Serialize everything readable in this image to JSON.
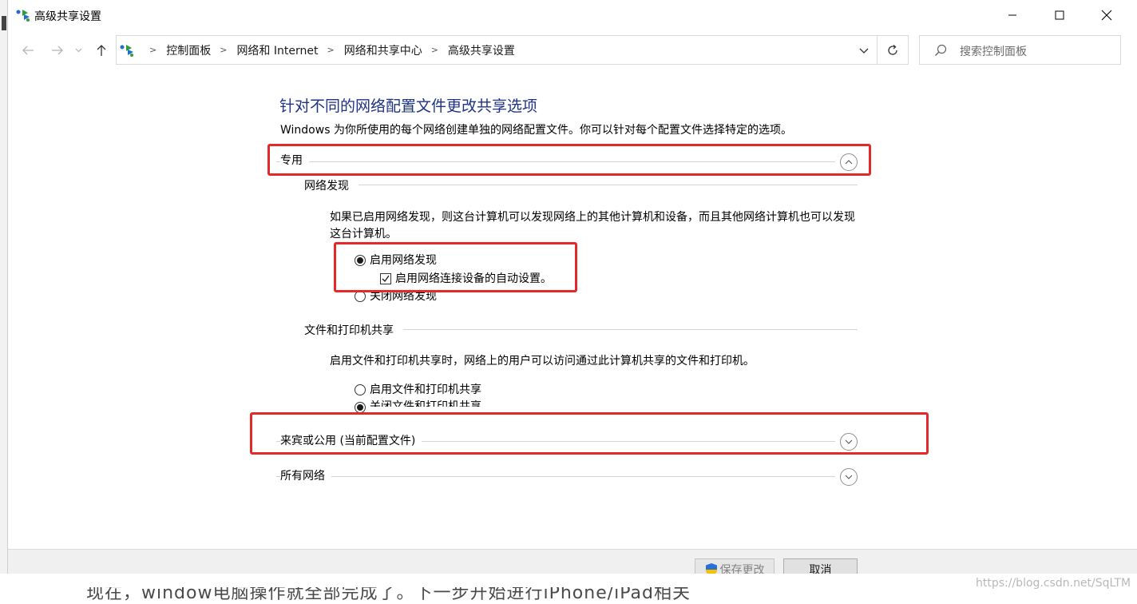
{
  "window": {
    "title": "高级共享设置",
    "controls": {
      "minimize": "—",
      "maximize": "☐",
      "close": "✕"
    }
  },
  "address_bar": {
    "breadcrumbs": [
      "控制面板",
      "网络和 Internet",
      "网络和共享中心",
      "高级共享设置"
    ]
  },
  "search": {
    "placeholder": "搜索控制面板"
  },
  "content": {
    "heading": "针对不同的网络配置文件更改共享选项",
    "description": "Windows 为你所使用的每个网络创建单独的网络配置文件。你可以针对每个配置文件选择特定的选项。",
    "profiles": {
      "private": {
        "label": "专用",
        "expanded": true,
        "network_discovery": {
          "label": "网络发现",
          "description": "如果已启用网络发现，则这台计算机可以发现网络上的其他计算机和设备，而且其他网络计算机也可以发现这台计算机。",
          "on_label": "启用网络发现",
          "auto_setup_label": "启用网络连接设备的自动设置。",
          "off_label": "关闭网络发现",
          "selected": "on",
          "auto_setup_checked": true
        },
        "file_printer_sharing": {
          "label": "文件和打印机共享",
          "description": "启用文件和打印机共享时，网络上的用户可以访问通过此计算机共享的文件和打印机。",
          "on_label": "启用文件和打印机共享",
          "off_label": "关闭文件和打印机共享",
          "selected": "off"
        }
      },
      "guest_public": {
        "label": "来宾或公用 (当前配置文件)",
        "expanded": false
      },
      "all_networks": {
        "label": "所有网络",
        "expanded": false
      }
    }
  },
  "footer": {
    "save_label": "保存更改",
    "save_enabled": false,
    "cancel_label": "取消"
  },
  "background": {
    "bottom_text": "现在，window电脑操作就全部完成了。下一步开始进行iPhone/iPad相关",
    "watermark": "https://blog.csdn.net/SqLTM"
  },
  "colors": {
    "heading": "#1e3287",
    "highlight_box": "#e5282a",
    "footer_bg": "#f0f0f0"
  },
  "icons": {
    "app": "network-sharing-icon",
    "back": "arrow-left-icon",
    "forward": "arrow-right-icon",
    "recent": "chevron-down-icon",
    "up": "arrow-up-icon",
    "refresh": "refresh-icon",
    "search": "search-icon",
    "expand": "chevron-circle-icon",
    "shield": "uac-shield-icon"
  }
}
